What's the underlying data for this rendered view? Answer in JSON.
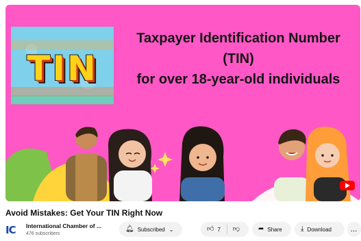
{
  "thumbnail": {
    "tin_logo": "TIN",
    "headline_line1": "Taxpayer Identification Number",
    "headline_line2": "(TIN)",
    "headline_line3": "for over 18-year-old individuals",
    "background_color": "#ff57c6"
  },
  "video": {
    "title": "Avoid Mistakes: Get Your TIN Right Now"
  },
  "channel": {
    "name": "International Chamber of ...",
    "subscribers": "476 subscribers",
    "avatar_text": "ICC"
  },
  "actions": {
    "subscribe_label": "Subscribed",
    "like_count": "7",
    "share_label": "Share",
    "download_label": "Download",
    "more_label": "..."
  },
  "icons": {
    "subscribe": "bell-icon",
    "like": "thumbs-up-icon",
    "dislike": "thumbs-down-icon",
    "share": "share-arrow-icon",
    "download": "download-icon",
    "more": "more-horizontal-icon"
  }
}
